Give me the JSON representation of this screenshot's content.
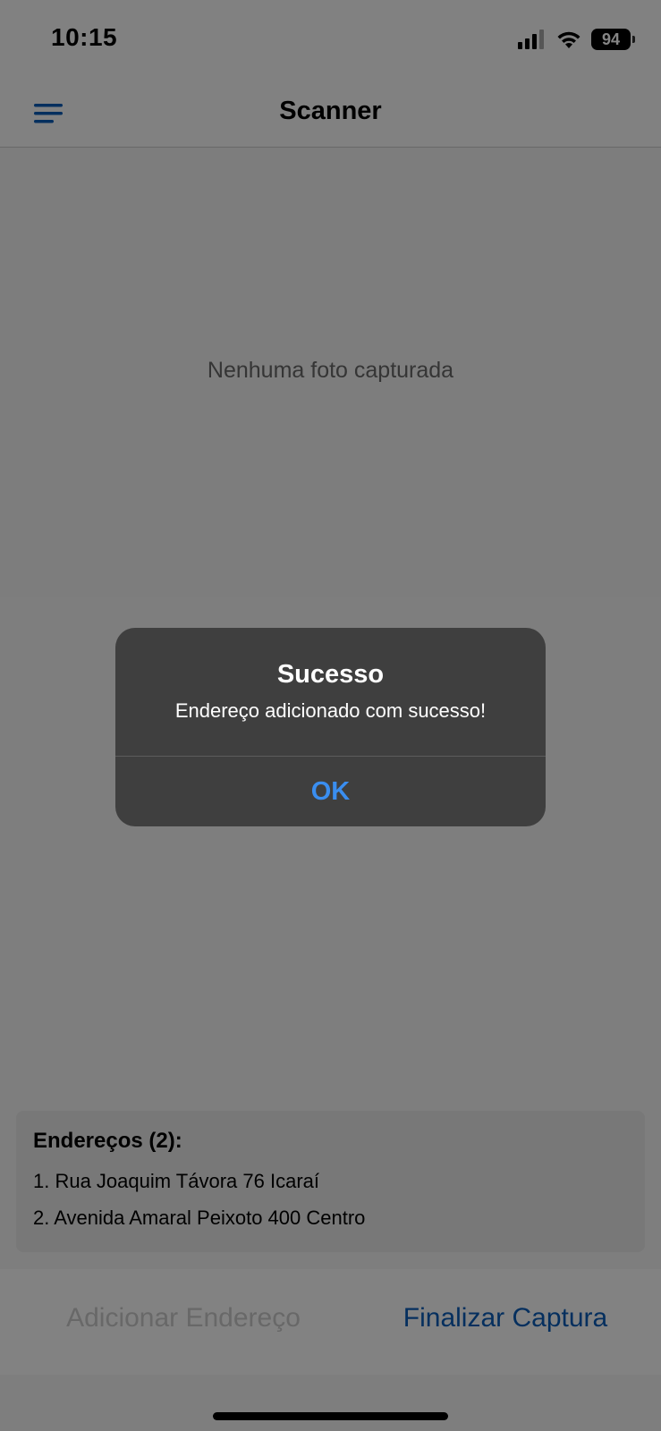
{
  "status_bar": {
    "time": "10:15",
    "battery": "94",
    "icons": [
      "signal-icon",
      "wifi-icon",
      "battery-icon"
    ]
  },
  "nav": {
    "title": "Scanner",
    "menu_icon": "menu-icon"
  },
  "photo": {
    "empty_text": "Nenhuma foto capturada"
  },
  "addresses": {
    "title": "Endereços (2):",
    "items": [
      "1. Rua Joaquim Távora 76 Icaraí",
      "2. Avenida Amaral Peixoto 400 Centro"
    ]
  },
  "actions": {
    "add_label": "Adicionar Endereço",
    "finish_label": "Finalizar Captura"
  },
  "alert": {
    "title": "Sucesso",
    "message": "Endereço adicionado com sucesso!",
    "ok_label": "OK"
  },
  "colors": {
    "accent": "#0a5bb5",
    "alert_button": "#3a8ef0",
    "disabled_text": "#c7c7c7"
  }
}
